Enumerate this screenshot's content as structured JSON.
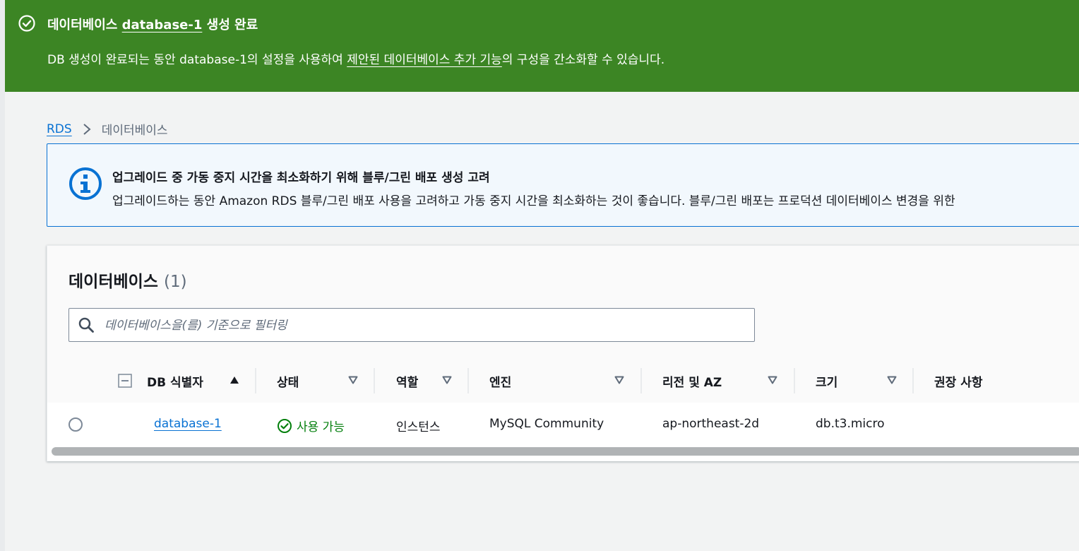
{
  "flash": {
    "title_prefix": "데이터베이스 ",
    "title_db": "database-1",
    "title_suffix": " 생성 완료",
    "body_prefix": "DB 생성이 완료되는 동안 database-1의 설정을 사용하여 ",
    "body_link": "제안된 데이터베이스 추가 기능",
    "body_suffix": "의 구성을 간소화할 수 있습니다.",
    "color": "#3c8524"
  },
  "breadcrumb": {
    "root": "RDS",
    "current": "데이터베이스"
  },
  "info_alert": {
    "title": "업그레이드 중 가동 중지 시간을 최소화하기 위해 블루/그린 배포 생성 고려",
    "text": "업그레이드하는 동안 Amazon RDS 블루/그린 배포 사용을 고려하고 가동 중지 시간을 최소화하는 것이 좋습니다. 블루/그린 배포는 프로덕션 데이터베이스 변경을 위한"
  },
  "panel": {
    "title": "데이터베이스",
    "count": "(1)",
    "search_placeholder": "데이터베이스을(를) 기준으로 필터링"
  },
  "table": {
    "columns": [
      "DB 식별자",
      "상태",
      "역할",
      "엔진",
      "리전 및 AZ",
      "크기",
      "권장 사항"
    ],
    "rows": [
      {
        "identifier": "database-1",
        "status": "사용 가능",
        "role": "인스턴스",
        "engine": "MySQL Community",
        "region_az": "ap-northeast-2d",
        "size": "db.t3.micro",
        "recommendations": ""
      }
    ]
  },
  "colors": {
    "link": "#0972d3",
    "success": "#037f0c",
    "info_border": "#0972d3"
  },
  "icons": {
    "flash": "check-circle-icon",
    "info": "info-circle-icon",
    "search": "search-icon",
    "sort_asc": "caret-up-icon",
    "sort": "caret-down-icon",
    "status": "check-circle-icon"
  }
}
